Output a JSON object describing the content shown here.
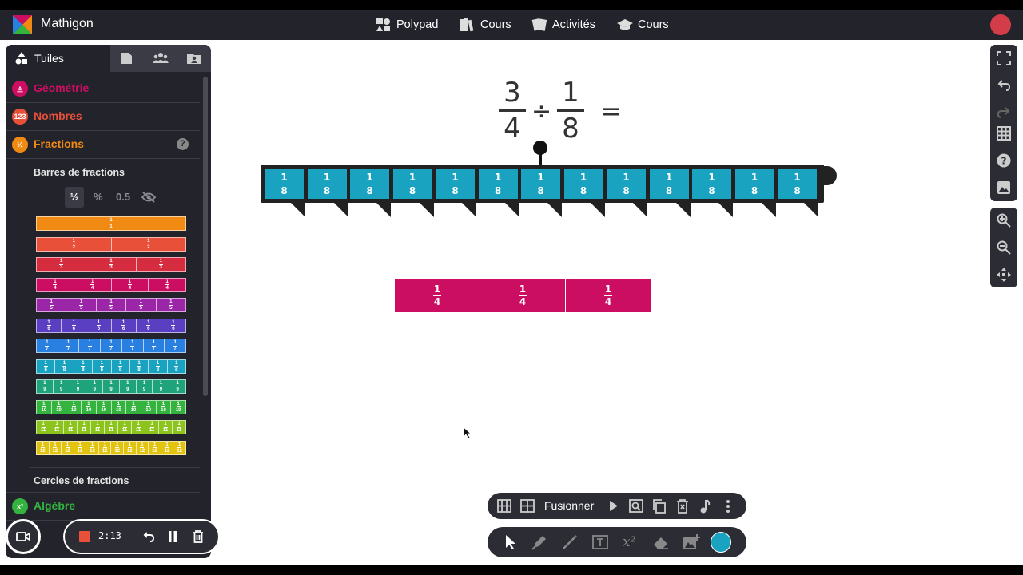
{
  "app": {
    "brand": "Mathigon"
  },
  "nav": [
    {
      "label": "Polypad",
      "icon": "polypad-icon"
    },
    {
      "label": "Cours",
      "icon": "books-icon"
    },
    {
      "label": "Activités",
      "icon": "cards-icon"
    },
    {
      "label": "Cours",
      "icon": "graduation-cap-icon"
    }
  ],
  "sidebar": {
    "tabs": [
      {
        "label": "Tuiles",
        "icon": "shapes-icon",
        "active": true
      },
      {
        "label": "",
        "icon": "file-icon"
      },
      {
        "label": "",
        "icon": "users-icon"
      },
      {
        "label": "",
        "icon": "folder-user-icon"
      }
    ],
    "categories": [
      {
        "label": "Géométrie",
        "color": "#cc0e63"
      },
      {
        "label": "Nombres",
        "color": "#e8503a"
      },
      {
        "label": "Fractions",
        "color": "#f18a12"
      },
      {
        "label": "Algèbre",
        "color": "#35b33f"
      }
    ],
    "fractions": {
      "subsection1": "Barres de fractions",
      "format_options": [
        "½",
        "%",
        "0.5"
      ],
      "subsection2": "Cercles de fractions",
      "bars": [
        {
          "denominator": 1,
          "color": "#f18a12"
        },
        {
          "denominator": 2,
          "color": "#e8503a"
        },
        {
          "denominator": 3,
          "color": "#d62c3f"
        },
        {
          "denominator": 4,
          "color": "#cc0e63"
        },
        {
          "denominator": 5,
          "color": "#9b26a8"
        },
        {
          "denominator": 6,
          "color": "#5a3fc2"
        },
        {
          "denominator": 7,
          "color": "#2a80e0"
        },
        {
          "denominator": 8,
          "color": "#1aa3c1"
        },
        {
          "denominator": 9,
          "color": "#1ea37a"
        },
        {
          "denominator": 10,
          "color": "#35b33f"
        },
        {
          "denominator": 11,
          "color": "#8cc31c"
        },
        {
          "denominator": 12,
          "color": "#e2c30f"
        }
      ]
    }
  },
  "canvas": {
    "equation": {
      "n1": "3",
      "d1": "4",
      "op": "÷",
      "n2": "1",
      "d2": "8",
      "eq": "="
    },
    "number_line": {
      "numerator": "1",
      "denominator": "8",
      "count": 13,
      "color": "#1aa3c1"
    },
    "pink_bar": {
      "numerator": "1",
      "denominator": "4",
      "count": 3,
      "color": "#cc0e63"
    }
  },
  "toolbar_top": {
    "merge_label": "Fusionner"
  },
  "recorder": {
    "time": "2:13"
  },
  "colors": {
    "current": "#1aa3c1"
  }
}
